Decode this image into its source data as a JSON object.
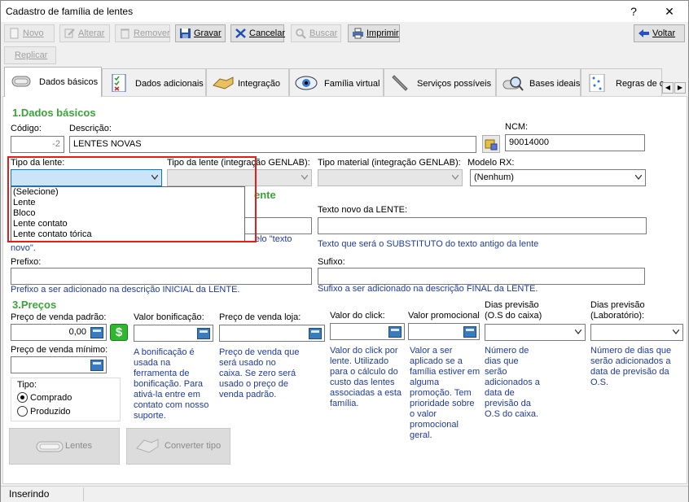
{
  "window": {
    "title": "Cadastro de família de lentes",
    "help": "?",
    "close": "✕"
  },
  "toolbar": {
    "novo": "Novo",
    "alterar": "Alterar",
    "remover": "Remover",
    "gravar": "Gravar",
    "cancelar": "Cancelar",
    "buscar": "Buscar",
    "imprimir": "Imprimir",
    "voltar": "Voltar",
    "replicar": "Replicar"
  },
  "tabs": [
    "Dados básicos",
    "Dados adicionais",
    "Integração",
    "Família virtual",
    "Serviços possíveis",
    "Bases ideais",
    "Regras de c"
  ],
  "section1": {
    "title": "1.Dados básicos",
    "codigo_label": "Código:",
    "codigo_value": "-2",
    "descricao_label": "Descrição:",
    "descricao_value": "LENTES NOVAS",
    "ncm_label": "NCM:",
    "ncm_value": "90014000",
    "tipo_lente_label": "Tipo da lente:",
    "tipo_lente_value": "",
    "tipo_genlab_label": "Tipo da lente (integração GENLAB):",
    "tipo_material_label": "Tipo material (integração GENLAB):",
    "modelo_rx_label": "Modelo RX:",
    "modelo_rx_value": "(Nenhum)"
  },
  "dropdown": {
    "options": [
      "(Selecione)",
      "Lente",
      "Bloco",
      "Lente contato",
      "Lente contato tórica"
    ]
  },
  "section2": {
    "title_partial": "ente",
    "hint_left_1": "elo \"texto",
    "hint_left_2": "novo\".",
    "texto_novo_label": "Texto novo da LENTE:",
    "texto_novo_hint": "Texto que será o SUBSTITUTO do texto antigo da lente",
    "prefixo_label": "Prefixo:",
    "prefixo_hint": "Prefixo a ser adicionado na descrição INICIAL da LENTE.",
    "sufixo_label": "Sufixo:",
    "sufixo_hint": "Sufixo a ser adicionado na descrição FINAL da LENTE."
  },
  "section3": {
    "title": "3.Preços",
    "preco_venda_label": "Preço de venda padrão:",
    "preco_venda_value": "0,00",
    "preco_minimo_label": "Preço de venda mínimo:",
    "bonificacao_label": "Valor bonificação:",
    "bonificacao_hint": [
      "A bonificação é",
      "usada na",
      "ferramenta de",
      "bonificação. Para",
      "ativá-la entre em",
      "contato com nosso",
      "suporte."
    ],
    "preco_loja_label": "Preço de venda loja:",
    "preco_loja_hint": [
      "Preço de venda que",
      "será usado no",
      "caixa. Se zero será",
      "usado o preço de",
      "venda padrão."
    ],
    "click_label": "Valor do click:",
    "click_hint": [
      "Valor do click por",
      "lente. Utilizado",
      "para o cálculo do",
      "custo das lentes",
      "associadas a esta",
      "família."
    ],
    "promo_label": "Valor promocional",
    "promo_hint": [
      "Valor a ser",
      "aplicado se a",
      "família estiver em",
      "alguma",
      "promoção. Tem",
      "prioridade sobre",
      "o valor",
      "promocional",
      "geral."
    ],
    "dias_caixa_label_1": "Dias previsão",
    "dias_caixa_label_2": "(O.S do caixa)",
    "dias_caixa_hint": [
      "Número de",
      "dias que",
      "serão",
      "adicionados a",
      "data de",
      "previsão da",
      "O.S do caixa."
    ],
    "dias_lab_label_1": "Dias previsão",
    "dias_lab_label_2": "(Laboratório):",
    "dias_lab_hint": [
      "Número de dias que",
      "serão adicionados a",
      "data de previsão da",
      "O.S."
    ],
    "tipo_label": "Tipo:",
    "comprado": "Comprado",
    "produzido": "Produzido"
  },
  "buttons": {
    "lentes": "Lentes",
    "converter": "Converter tipo"
  },
  "status": {
    "text": "Inserindo"
  }
}
